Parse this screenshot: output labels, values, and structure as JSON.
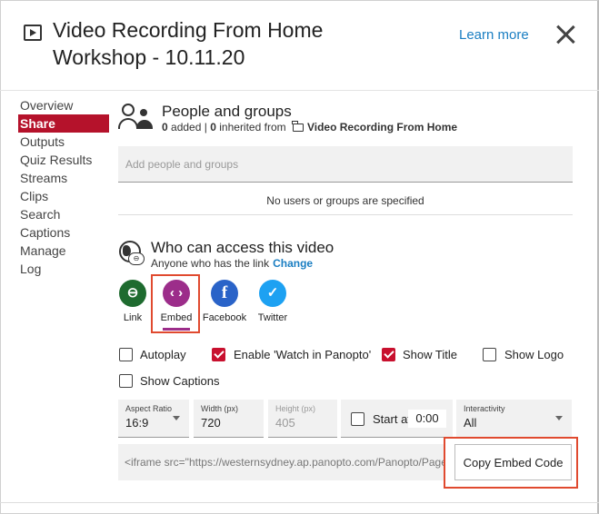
{
  "header": {
    "title": "Video Recording From Home Workshop - 10.11.20",
    "learn_more": "Learn more"
  },
  "sidebar": {
    "items": [
      {
        "label": "Overview"
      },
      {
        "label": "Share"
      },
      {
        "label": "Outputs"
      },
      {
        "label": "Quiz Results"
      },
      {
        "label": "Streams"
      },
      {
        "label": "Clips"
      },
      {
        "label": "Search"
      },
      {
        "label": "Captions"
      },
      {
        "label": "Manage"
      },
      {
        "label": "Log"
      }
    ],
    "active_index": 1
  },
  "people": {
    "title": "People and groups",
    "added_count": "0",
    "added_text": "added",
    "separator": "|",
    "inherited_count": "0",
    "inherited_text": "inherited from",
    "folder_name": "Video Recording From Home",
    "input_placeholder": "Add people and groups",
    "empty_message": "No users or groups are specified"
  },
  "access": {
    "title": "Who can access this video",
    "subtitle": "Anyone who has the link",
    "change_label": "Change",
    "link_badge": "⊖"
  },
  "share_options": [
    {
      "label": "Link",
      "icon": "link-icon",
      "glyph": "⊖",
      "color": "#1e6b2f"
    },
    {
      "label": "Embed",
      "icon": "embed-icon",
      "glyph": "‹ ›",
      "color": "#9c2d8a"
    },
    {
      "label": "Facebook",
      "icon": "facebook-icon",
      "glyph": "f",
      "color": "#2a63c8"
    },
    {
      "label": "Twitter",
      "icon": "twitter-icon",
      "glyph": "✓",
      "color": "#1da1f2"
    }
  ],
  "selected_share": "Embed",
  "embed_options": {
    "autoplay": {
      "label": "Autoplay",
      "checked": false
    },
    "watch_in_panopto": {
      "label": "Enable 'Watch in Panopto'",
      "checked": true
    },
    "show_title": {
      "label": "Show Title",
      "checked": true
    },
    "show_logo": {
      "label": "Show Logo",
      "checked": false
    },
    "show_captions": {
      "label": "Show Captions",
      "checked": false
    }
  },
  "fields": {
    "aspect_ratio": {
      "label": "Aspect Ratio",
      "value": "16:9"
    },
    "width": {
      "label": "Width (px)",
      "value": "720"
    },
    "height": {
      "label": "Height (px)",
      "value": "405"
    },
    "start_at": {
      "label": "Start at",
      "value": "0:00",
      "checked": false
    },
    "interactivity": {
      "label": "Interactivity",
      "value": "All"
    }
  },
  "embed_code": "<iframe src=\"https://westernsydney.ap.panopto.com/Panopto/Pages/Embed",
  "copy_button": "Copy Embed Code",
  "colors": {
    "accent_red": "#b5122b",
    "link_blue": "#1a7ec2",
    "highlight_border": "#e04a2f"
  }
}
